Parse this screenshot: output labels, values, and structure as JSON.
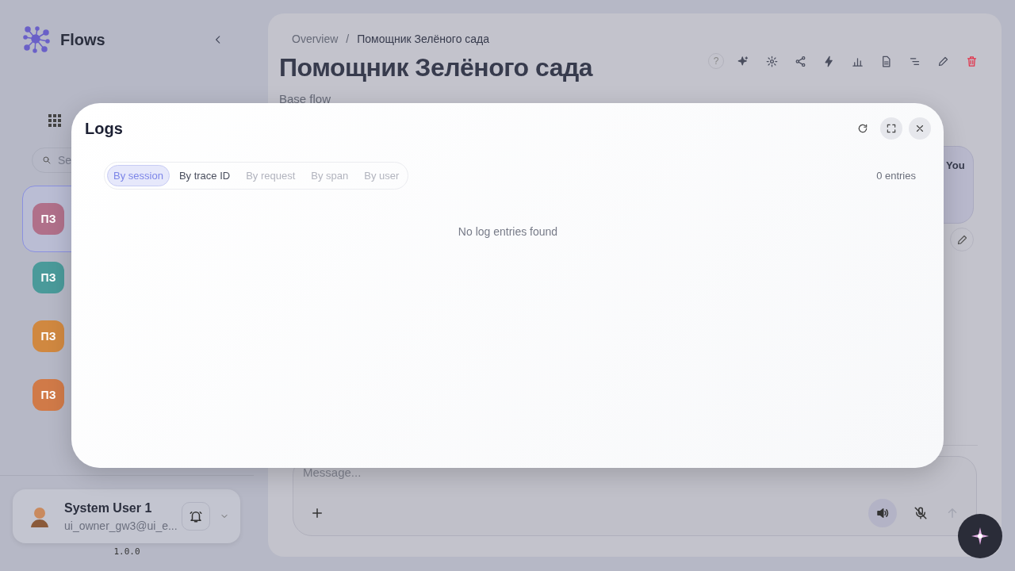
{
  "sidebar": {
    "brand": "Flows",
    "search": {
      "placeholder": "Se"
    },
    "sessions": [
      {
        "initials": "ПЗ",
        "color": "#b0708a",
        "selected": true
      },
      {
        "initials": "ПЗ",
        "color": "#4a9a9a",
        "selected": false
      },
      {
        "initials": "ПЗ",
        "color": "#d08840",
        "selected": false
      },
      {
        "initials": "ПЗ",
        "color": "#d07a48",
        "selected": false
      }
    ],
    "user": {
      "name": "System User 1",
      "email": "ui_owner_gw3@ui_e..."
    },
    "version": "1.0.0"
  },
  "main": {
    "breadcrumb": [
      "Overview",
      "Помощник Зелёного сада"
    ],
    "breadcrumb_separator": "/",
    "title": "Помощник Зелёного сада",
    "subtitle": "Base flow",
    "toolbar": [
      {
        "kind": "help",
        "glyph": "?"
      },
      {
        "kind": "sparkles"
      },
      {
        "kind": "gear"
      },
      {
        "kind": "share"
      },
      {
        "kind": "bolt"
      },
      {
        "kind": "chart"
      },
      {
        "kind": "document"
      },
      {
        "kind": "list"
      },
      {
        "kind": "pencil"
      },
      {
        "kind": "trash"
      }
    ],
    "message": {
      "author": "You"
    },
    "composer": {
      "placeholder": "Message...",
      "speaker_on": true,
      "send_disabled": true
    }
  },
  "dialog": {
    "title": "Logs",
    "tabs": [
      {
        "label": "By session",
        "selected": true,
        "disabled": false
      },
      {
        "label": "By trace ID",
        "selected": false,
        "disabled": false
      },
      {
        "label": "By request",
        "selected": false,
        "disabled": true
      },
      {
        "label": "By span",
        "selected": false,
        "disabled": true
      },
      {
        "label": "By user",
        "selected": false,
        "disabled": true
      }
    ],
    "count": "0 entries",
    "empty": "No log entries found"
  }
}
